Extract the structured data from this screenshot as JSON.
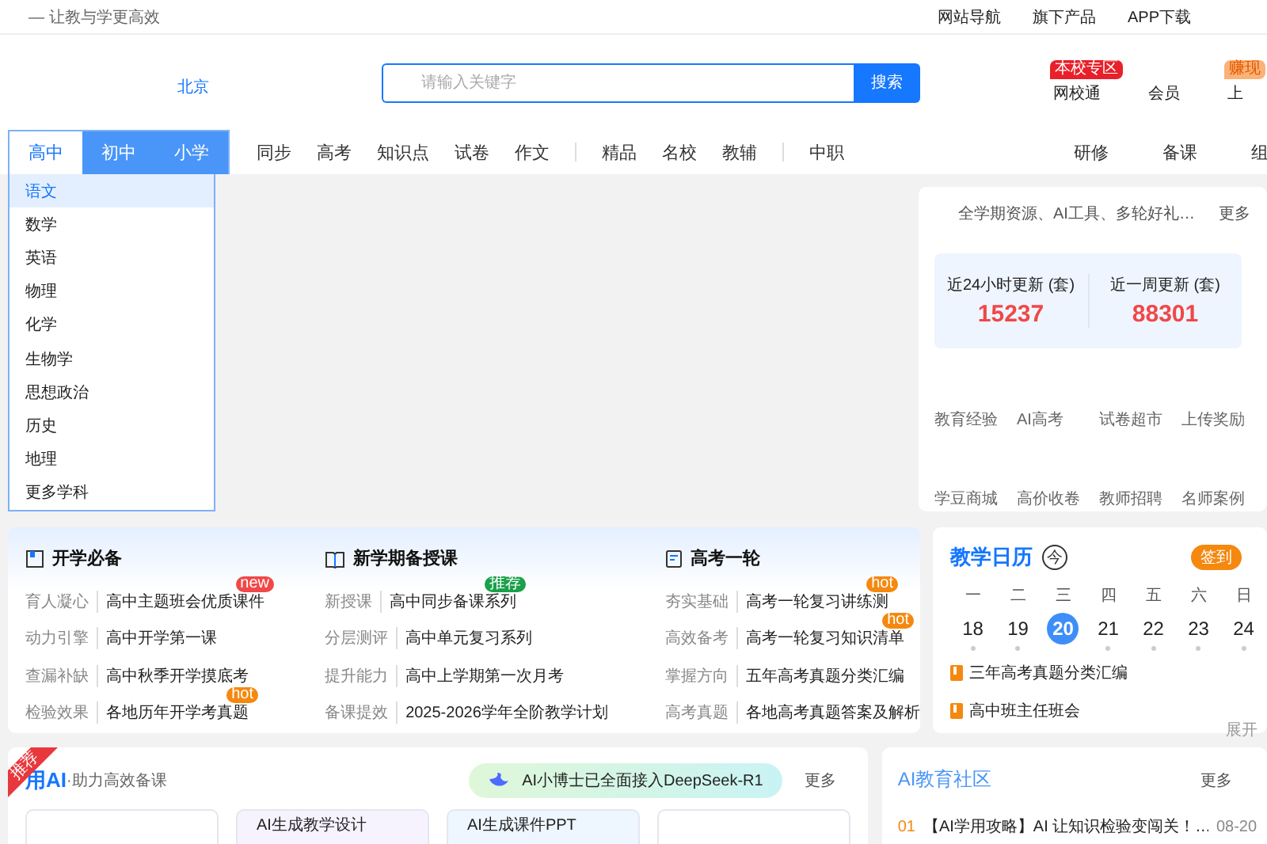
{
  "top_bar": {
    "slogan": "— 让教与学更高效",
    "links": [
      "网站导航",
      "旗下产品",
      "APP下载"
    ]
  },
  "header": {
    "city": "北京",
    "search": {
      "placeholder": "请输入关键字",
      "button": "搜索"
    },
    "shortcuts": [
      {
        "label": "网校通",
        "badge": "本校专区"
      },
      {
        "label": "会员"
      },
      {
        "label": "上",
        "badge": "赚现"
      }
    ]
  },
  "nav": {
    "levels": [
      {
        "label": "高中",
        "selected": true
      },
      {
        "label": "初中",
        "selected": false
      },
      {
        "label": "小学",
        "selected": false
      }
    ],
    "link_groups": [
      [
        "同步",
        "高考",
        "知识点",
        "试卷",
        "作文"
      ],
      [
        "精品",
        "名校",
        "教辅"
      ],
      [
        "中职"
      ]
    ],
    "right_links": [
      "研修",
      "备课",
      "组"
    ]
  },
  "subject_menu": [
    {
      "label": "语文",
      "selected": true
    },
    {
      "label": "数学",
      "selected": false
    },
    {
      "label": "英语",
      "selected": false
    },
    {
      "label": "物理",
      "selected": false
    },
    {
      "label": "化学",
      "selected": false
    },
    {
      "label": "生物学",
      "selected": false
    },
    {
      "label": "思想政治",
      "selected": false
    },
    {
      "label": "历史",
      "selected": false
    },
    {
      "label": "地理",
      "selected": false
    },
    {
      "label": "更多学科",
      "selected": false
    }
  ],
  "resource_card": {
    "promo": "全学期资源、AI工具、多轮好礼…",
    "more": "更多",
    "stats": [
      {
        "label": "近24小时更新 (套)",
        "value": "15237"
      },
      {
        "label": "近一周更新 (套)",
        "value": "88301"
      }
    ],
    "links": [
      "教育经验",
      "AI高考",
      "试卷超市",
      "上传奖励",
      "学豆商城",
      "高价收卷",
      "教师招聘",
      "名师案例"
    ]
  },
  "featured": {
    "columns": [
      {
        "title": "开学必备",
        "items": [
          {
            "category": "育人凝心",
            "title": "高中主题班会优质课件",
            "tag": {
              "text": "new",
              "color": "#f04848"
            }
          },
          {
            "category": "动力引擎",
            "title": "高中开学第一课"
          },
          {
            "category": "查漏补缺",
            "title": "高中秋季开学摸底考"
          },
          {
            "category": "检验效果",
            "title": "各地历年开学考真题",
            "tag": {
              "text": "hot",
              "color": "#f5880f"
            }
          }
        ]
      },
      {
        "title": "新学期备授课",
        "items": [
          {
            "category": "新授课",
            "title": "高中同步备课系列",
            "tag": {
              "text": "推荐",
              "color": "#1aa04a"
            }
          },
          {
            "category": "分层测评",
            "title": "高中单元复习系列"
          },
          {
            "category": "提升能力",
            "title": "高中上学期第一次月考"
          },
          {
            "category": "备课提效",
            "title": "2025-2026学年全阶教学计划"
          }
        ]
      },
      {
        "title": "高考一轮",
        "items": [
          {
            "category": "夯实基础",
            "title": "高考一轮复习讲练测",
            "tag": {
              "text": "hot",
              "color": "#f5880f"
            }
          },
          {
            "category": "高效备考",
            "title": "高考一轮复习知识清单",
            "tag": {
              "text": "hot",
              "color": "#f5880f"
            }
          },
          {
            "category": "掌握方向",
            "title": "五年高考真题分类汇编"
          },
          {
            "category": "高考真题",
            "title": "各地高考真题答案及解析"
          }
        ]
      }
    ]
  },
  "calendar": {
    "title": "教学日历",
    "today_mark": "今",
    "checkin": "签到",
    "weekdays": [
      "一",
      "二",
      "三",
      "四",
      "五",
      "六",
      "日"
    ],
    "days": [
      {
        "label": "18",
        "selected": false
      },
      {
        "label": "19",
        "selected": false
      },
      {
        "label": "20",
        "selected": true
      },
      {
        "label": "21",
        "selected": false
      },
      {
        "label": "22",
        "selected": false
      },
      {
        "label": "23",
        "selected": false
      },
      {
        "label": "24",
        "selected": false
      }
    ],
    "events": [
      "三年高考真题分类汇编",
      "高中班主任班会"
    ],
    "expand": "展开"
  },
  "ai_section": {
    "corner_badge": "推荐",
    "title": "用AI",
    "subtitle": "·助力高效备课",
    "promo": "AI小博士已全面接入DeepSeek-R1",
    "more": "更多",
    "cards": [
      {
        "kind": "blank"
      },
      {
        "kind": "titled",
        "title": "AI生成教学设计"
      },
      {
        "kind": "titled",
        "title": "AI生成课件PPT"
      },
      {
        "kind": "blank"
      }
    ]
  },
  "community": {
    "title": "AI教育社区",
    "more": "更多",
    "posts": [
      {
        "rank": "01",
        "title": "【AI学用攻略】AI 让知识检验变闯关！…",
        "date": "08-20"
      }
    ]
  }
}
